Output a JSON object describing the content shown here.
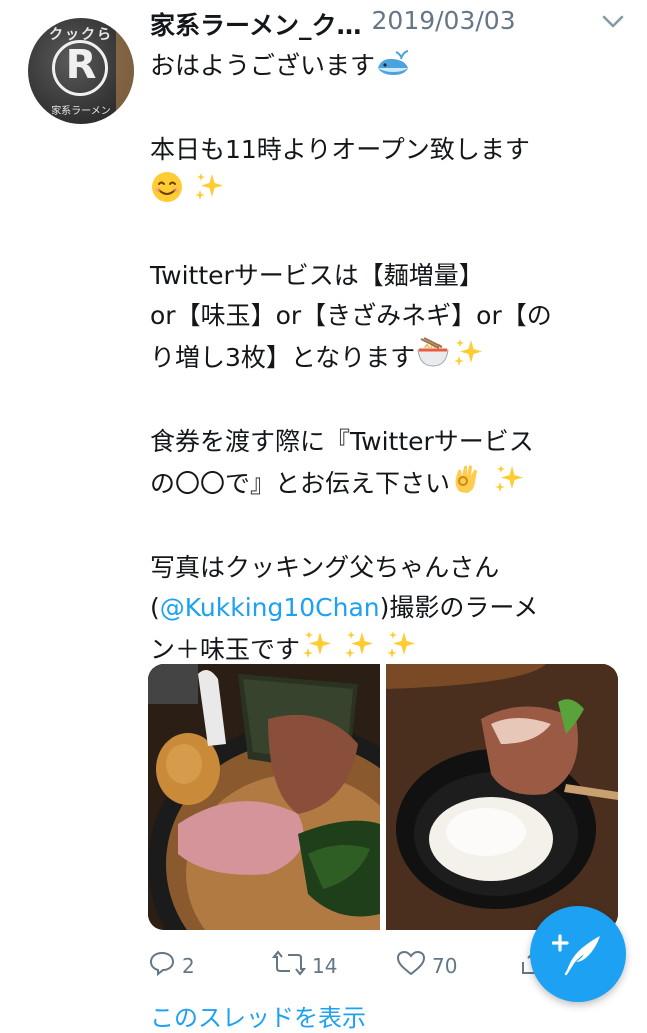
{
  "tweet": {
    "author_name": "家系ラーメン_ク…",
    "date": "2019/03/03",
    "avatar": {
      "top_text": "クックら",
      "letter": "R",
      "bottom_text": "家系ラーメン"
    },
    "lines": {
      "l1": "おはようございます",
      "l2": "本日も11時よりオープン致します",
      "l3": "Twitterサービスは【麺増量】",
      "l4": "or【味玉】or【きざみネギ】or【の",
      "l5": "り増し3枚】となります",
      "l6": "食券を渡す際に『Twitterサービス",
      "l7": "の〇〇で』とお伝え下さい",
      "l8": "写真はクッキング父ちゃんさん",
      "l9_pre": "(",
      "l9_mention": "@Kukking10Chan",
      "l9_post": ")撮影のラーメ",
      "l10": "ン＋味玉です"
    },
    "emojis": {
      "whale": "whale-emoji",
      "smile": "smile-emoji",
      "sparkles": "sparkles-emoji",
      "ramen": "ramen-emoji",
      "ok_hand": "ok-hand-emoji"
    },
    "media": [
      {
        "alt": "ramen-photo"
      },
      {
        "alt": "rice-bowl-photo"
      }
    ],
    "actions": {
      "replies": "2",
      "retweets": "14",
      "likes": "70"
    },
    "thread_link": "このスレッドを表示"
  },
  "compose_button": {
    "icon": "compose-feather-icon"
  },
  "colors": {
    "accent": "#1da1f2",
    "muted": "#657786",
    "text": "#14171a"
  }
}
